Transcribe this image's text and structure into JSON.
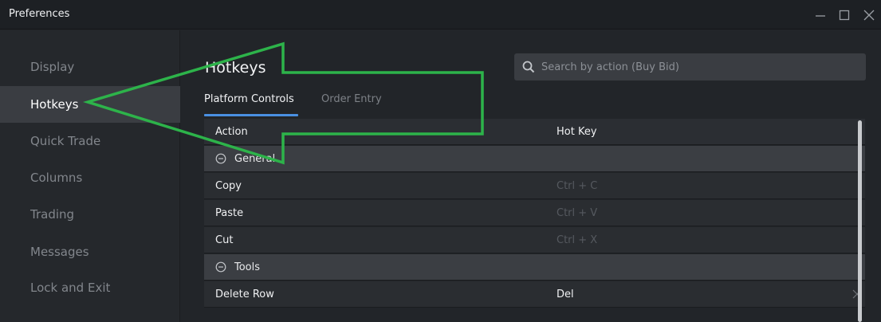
{
  "window": {
    "title": "Preferences",
    "controls": [
      "minimize-icon",
      "maximize-icon",
      "close-icon"
    ]
  },
  "sidebar": {
    "items": [
      {
        "label": "Display",
        "active": false
      },
      {
        "label": "Hotkeys",
        "active": true
      },
      {
        "label": "Quick Trade",
        "active": false
      },
      {
        "label": "Columns",
        "active": false
      },
      {
        "label": "Trading",
        "active": false
      },
      {
        "label": "Messages",
        "active": false
      },
      {
        "label": "Lock and Exit",
        "active": false
      }
    ]
  },
  "main": {
    "title": "Hotkeys",
    "search": {
      "placeholder": "Search by action (Buy Bid)",
      "value": ""
    },
    "tabs": [
      {
        "label": "Platform Controls",
        "active": true
      },
      {
        "label": "Order Entry",
        "active": false
      }
    ],
    "table": {
      "headers": {
        "action": "Action",
        "hotkey": "Hot Key"
      },
      "groups": [
        {
          "label": "General",
          "rows": [
            {
              "action": "Copy",
              "hotkey": "Ctrl + C"
            },
            {
              "action": "Paste",
              "hotkey": "Ctrl + V"
            },
            {
              "action": "Cut",
              "hotkey": "Ctrl + X"
            }
          ]
        },
        {
          "label": "Tools",
          "rows": [
            {
              "action": "Delete Row",
              "hotkey": "Del"
            }
          ]
        }
      ]
    }
  },
  "colors": {
    "accent": "#4a90e2",
    "annotation": "#2db34a"
  }
}
